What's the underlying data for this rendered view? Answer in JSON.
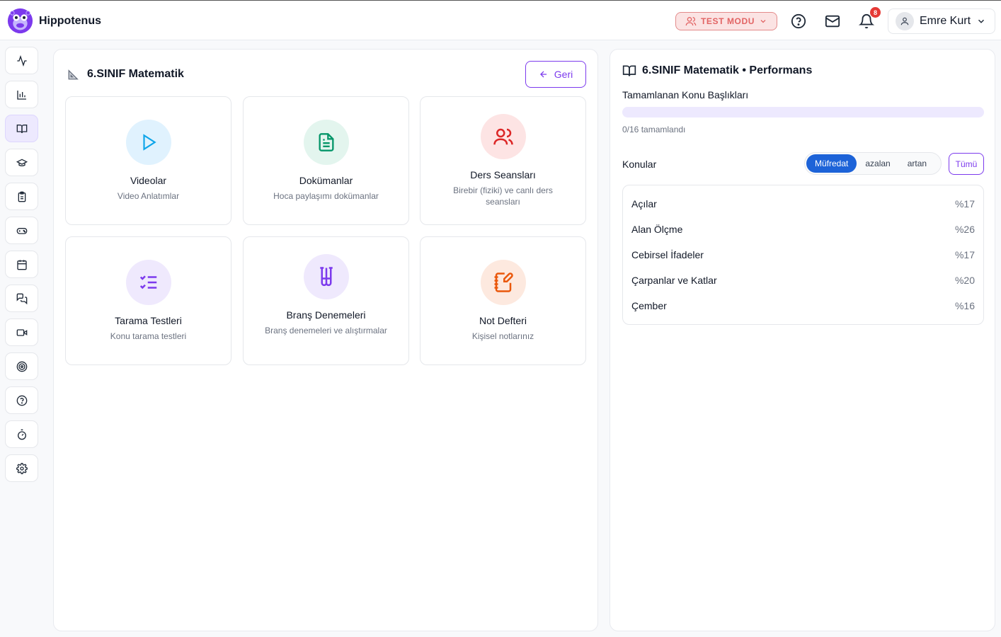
{
  "app": {
    "name": "Hippotenus"
  },
  "header": {
    "test_mode_label": "TEST MODU",
    "notification_count": "8",
    "user_name": "Emre Kurt"
  },
  "sidebar": {
    "items": [
      {
        "icon": "activity-icon",
        "active": false
      },
      {
        "icon": "bar-chart-icon",
        "active": false
      },
      {
        "icon": "book-open-icon",
        "active": true
      },
      {
        "icon": "graduation-cap-icon",
        "active": false
      },
      {
        "icon": "clipboard-icon",
        "active": false
      },
      {
        "icon": "gamepad-icon",
        "active": false
      },
      {
        "icon": "calendar-icon",
        "active": false
      },
      {
        "icon": "messages-icon",
        "active": false
      },
      {
        "icon": "video-icon",
        "active": false
      },
      {
        "icon": "target-icon",
        "active": false
      },
      {
        "icon": "help-circle-icon",
        "active": false
      },
      {
        "icon": "timer-icon",
        "active": false
      },
      {
        "icon": "settings-icon",
        "active": false
      }
    ]
  },
  "main": {
    "title": "6.SINIF Matematik",
    "back_label": "Geri",
    "cards": [
      {
        "title": "Videolar",
        "subtitle": "Video Anlatımlar",
        "icon": "play-icon",
        "color": "#0ea5e9",
        "bg": "#e0f2fe"
      },
      {
        "title": "Dokümanlar",
        "subtitle": "Hoca paylaşımı dokümanlar",
        "icon": "file-text-icon",
        "color": "#059669",
        "bg": "#e3f5ee"
      },
      {
        "title": "Ders Seansları",
        "subtitle": "Birebir (fiziki) ve canlı ders seansları",
        "icon": "users-icon",
        "color": "#dc2626",
        "bg": "#fde4e4"
      },
      {
        "title": "Tarama Testleri",
        "subtitle": "Konu tarama testleri",
        "icon": "list-checks-icon",
        "color": "#7c3aed",
        "bg": "#efe9fd"
      },
      {
        "title": "Branş Denemeleri",
        "subtitle": "Branş denemeleri ve alıştırmalar",
        "icon": "test-tubes-icon",
        "color": "#7c3aed",
        "bg": "#efe9fd"
      },
      {
        "title": "Not Defteri",
        "subtitle": "Kişisel notlarınız",
        "icon": "notebook-pen-icon",
        "color": "#ea580c",
        "bg": "#fde9df"
      }
    ]
  },
  "performance": {
    "title": "6.SINIF Matematik • Performans",
    "completed_label": "Tamamlanan Konu Başlıkları",
    "progress_fraction": 0,
    "status": "0/16 tamamlandı",
    "topics_label": "Konular",
    "sort_options": [
      "Müfredat",
      "azalan",
      "artan"
    ],
    "sort_selected": "Müfredat",
    "all_label": "Tümü",
    "topics": [
      {
        "name": "Açılar",
        "percent": "%17"
      },
      {
        "name": "Alan Ölçme",
        "percent": "%26"
      },
      {
        "name": "Cebirsel İfadeler",
        "percent": "%17"
      },
      {
        "name": "Çarpanlar ve Katlar",
        "percent": "%20"
      },
      {
        "name": "Çember",
        "percent": "%16"
      }
    ]
  }
}
